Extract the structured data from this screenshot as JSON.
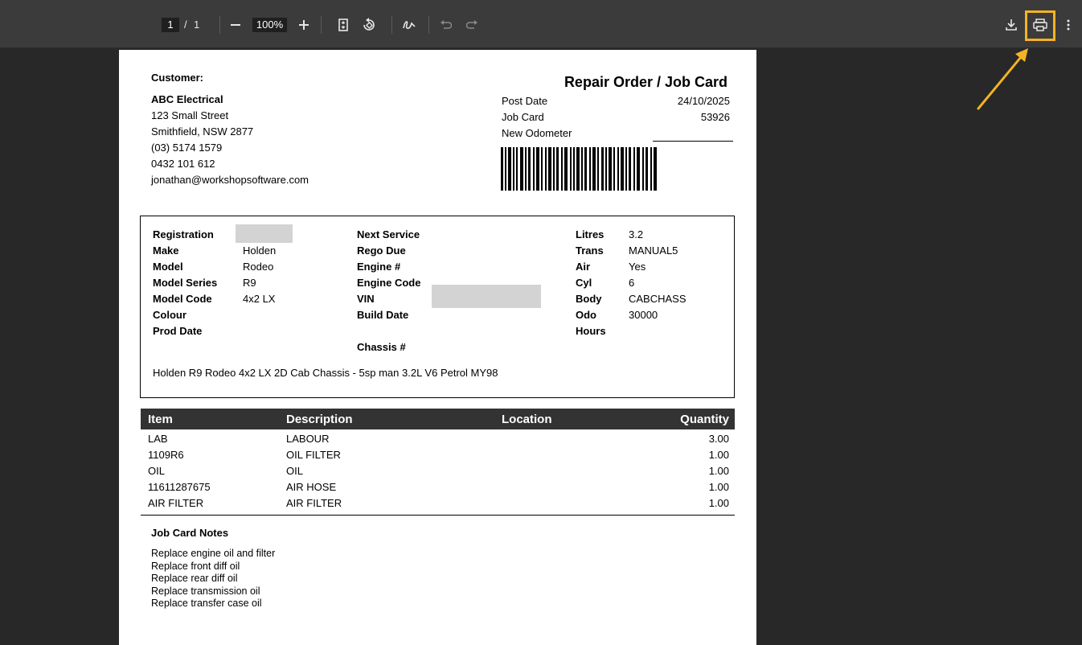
{
  "toolbar": {
    "page_current": "1",
    "page_sep": "/",
    "page_total": "1",
    "zoom": "100%",
    "icons": [
      "minus-icon",
      "plus-icon",
      "fit-page-icon",
      "rotate-icon",
      "annotate-icon",
      "undo-icon",
      "redo-icon",
      "download-icon",
      "print-icon",
      "more-icon"
    ],
    "highlight_color": "#f4b324"
  },
  "doc": {
    "customer_heading": "Customer:",
    "customer": {
      "name": "ABC Electrical",
      "street": "123 Small Street",
      "city": "Smithfield, NSW 2877",
      "phone": "(03) 5174 1579",
      "mobile": "0432 101 612",
      "email": "jonathan@workshopsoftware.com"
    },
    "title": "Repair Order / Job Card",
    "post_date_label": "Post Date",
    "post_date": "24/10/2025",
    "job_card_label": "Job Card",
    "job_card": "53926",
    "odometer_label": "New Odometer",
    "vehicle": {
      "col1": [
        {
          "label": "Registration",
          "value": ""
        },
        {
          "label": "Make",
          "value": "Holden"
        },
        {
          "label": "Model",
          "value": "Rodeo"
        },
        {
          "label": "Model Series",
          "value": "R9"
        },
        {
          "label": "Model Code",
          "value": "4x2 LX"
        },
        {
          "label": "Colour",
          "value": ""
        },
        {
          "label": "Prod Date",
          "value": ""
        }
      ],
      "col2": [
        {
          "label": "Next Service",
          "value": ""
        },
        {
          "label": "Rego Due",
          "value": ""
        },
        {
          "label": "Engine #",
          "value": ""
        },
        {
          "label": "Engine Code",
          "value": ""
        },
        {
          "label": "VIN",
          "value": ""
        },
        {
          "label": "Build Date",
          "value": ""
        },
        {
          "label": "",
          "value": ""
        },
        {
          "label": "Chassis #",
          "value": ""
        }
      ],
      "col3": [
        {
          "label": "Litres",
          "value": "3.2"
        },
        {
          "label": "Trans",
          "value": "MANUAL5"
        },
        {
          "label": "Air",
          "value": "Yes"
        },
        {
          "label": "Cyl",
          "value": "6"
        },
        {
          "label": "Body",
          "value": "CABCHASS"
        },
        {
          "label": "Odo",
          "value": "30000"
        },
        {
          "label": "Hours",
          "value": ""
        }
      ],
      "description": "Holden R9 Rodeo 4x2 LX 2D Cab Chassis - 5sp man 3.2L V6 Petrol MY98"
    },
    "table": {
      "headers": [
        "Item",
        "Description",
        "Location",
        "Quantity"
      ],
      "rows": [
        {
          "item": "LAB",
          "description": "LABOUR",
          "location": "",
          "quantity": "3.00"
        },
        {
          "item": "1109R6",
          "description": "OIL FILTER",
          "location": "",
          "quantity": "1.00"
        },
        {
          "item": "OIL",
          "description": "OIL",
          "location": "",
          "quantity": "1.00"
        },
        {
          "item": "11611287675",
          "description": "AIR HOSE",
          "location": "",
          "quantity": "1.00"
        },
        {
          "item": "AIR FILTER",
          "description": "AIR FILTER",
          "location": "",
          "quantity": "1.00"
        }
      ]
    },
    "notes_heading": "Job Card Notes",
    "notes": [
      "Replace engine oil and filter",
      "Replace front diff oil",
      "Replace rear diff oil",
      "Replace transmission oil",
      "Replace transfer case oil"
    ]
  }
}
